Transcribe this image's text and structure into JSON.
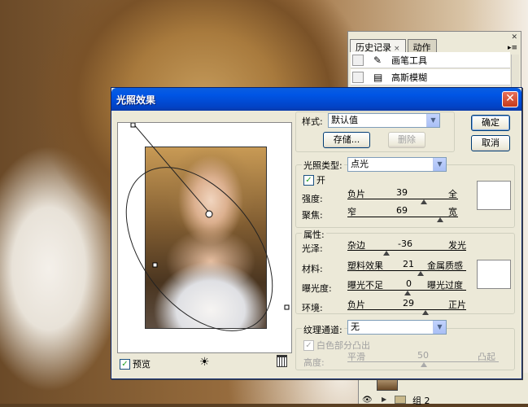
{
  "history_panel": {
    "tabs": [
      "历史记录",
      "动作"
    ],
    "close_glyph": "×",
    "items": [
      {
        "label": "画笔工具",
        "icon": "brush-icon"
      },
      {
        "label": "高斯模糊",
        "icon": "filter-icon"
      }
    ]
  },
  "layers_panel": {
    "group_name": "组 2"
  },
  "dialog": {
    "title": "光照效果",
    "style": {
      "label": "样式:",
      "value": "默认值"
    },
    "save_button": "存储...",
    "delete_button": "删除",
    "ok_button": "确定",
    "cancel_button": "取消",
    "light_type": {
      "label": "光照类型:",
      "value": "点光"
    },
    "on_label": "开",
    "on_checked": true,
    "intensity": {
      "label": "强度:",
      "min_label": "负片",
      "max_label": "全",
      "value": "39"
    },
    "focus": {
      "label": "聚焦:",
      "min_label": "窄",
      "max_label": "宽",
      "value": "69"
    },
    "properties_label": "属性:",
    "gloss": {
      "label": "光泽:",
      "min_label": "杂边",
      "max_label": "发光",
      "value": "-36"
    },
    "material": {
      "label": "材料:",
      "min_label": "塑料效果",
      "max_label": "金属质感",
      "value": "21"
    },
    "exposure": {
      "label": "曝光度:",
      "min_label": "曝光不足",
      "max_label": "曝光过度",
      "value": "0"
    },
    "ambience": {
      "label": "环境:",
      "min_label": "负片",
      "max_label": "正片",
      "value": "29"
    },
    "texture_channel": {
      "label": "纹理通道:",
      "value": "无"
    },
    "white_high": {
      "label": "白色部分凸出",
      "checked": true
    },
    "height": {
      "label": "高度:",
      "min_label": "平滑",
      "max_label": "凸起",
      "value": "50"
    },
    "preview": {
      "label": "预览",
      "checked": true
    }
  }
}
